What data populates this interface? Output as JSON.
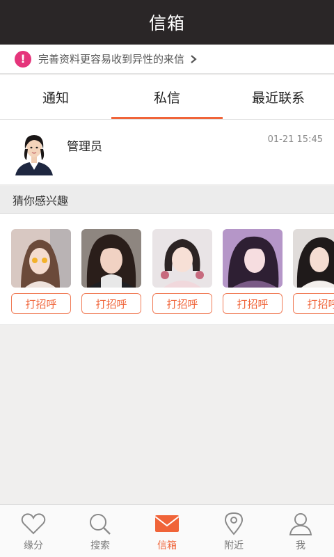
{
  "header": {
    "title": "信箱"
  },
  "notice": {
    "icon": "exclamation-icon",
    "text": "完善资料更容易收到异性的来信"
  },
  "tabs": [
    {
      "label": "通知",
      "active": false
    },
    {
      "label": "私信",
      "active": true
    },
    {
      "label": "最近联系",
      "active": false
    }
  ],
  "conversation": {
    "name": "管理员",
    "time": "01-21 15:45"
  },
  "recommend": {
    "heading": "猜你感兴趣",
    "greet_label": "打招呼",
    "cards": [
      {
        "photo": "user-photo-1"
      },
      {
        "photo": "user-photo-2"
      },
      {
        "photo": "user-photo-3"
      },
      {
        "photo": "user-photo-4"
      },
      {
        "photo": "user-photo-5"
      }
    ]
  },
  "bottom_nav": [
    {
      "label": "缘分",
      "icon": "heart-icon",
      "active": false
    },
    {
      "label": "搜索",
      "icon": "search-icon",
      "active": false
    },
    {
      "label": "信箱",
      "icon": "mail-icon",
      "active": true
    },
    {
      "label": "附近",
      "icon": "location-icon",
      "active": false
    },
    {
      "label": "我",
      "icon": "user-icon",
      "active": false
    }
  ],
  "colors": {
    "accent": "#f06439",
    "titlebar": "#2a2627",
    "alert": "#e5357b"
  }
}
